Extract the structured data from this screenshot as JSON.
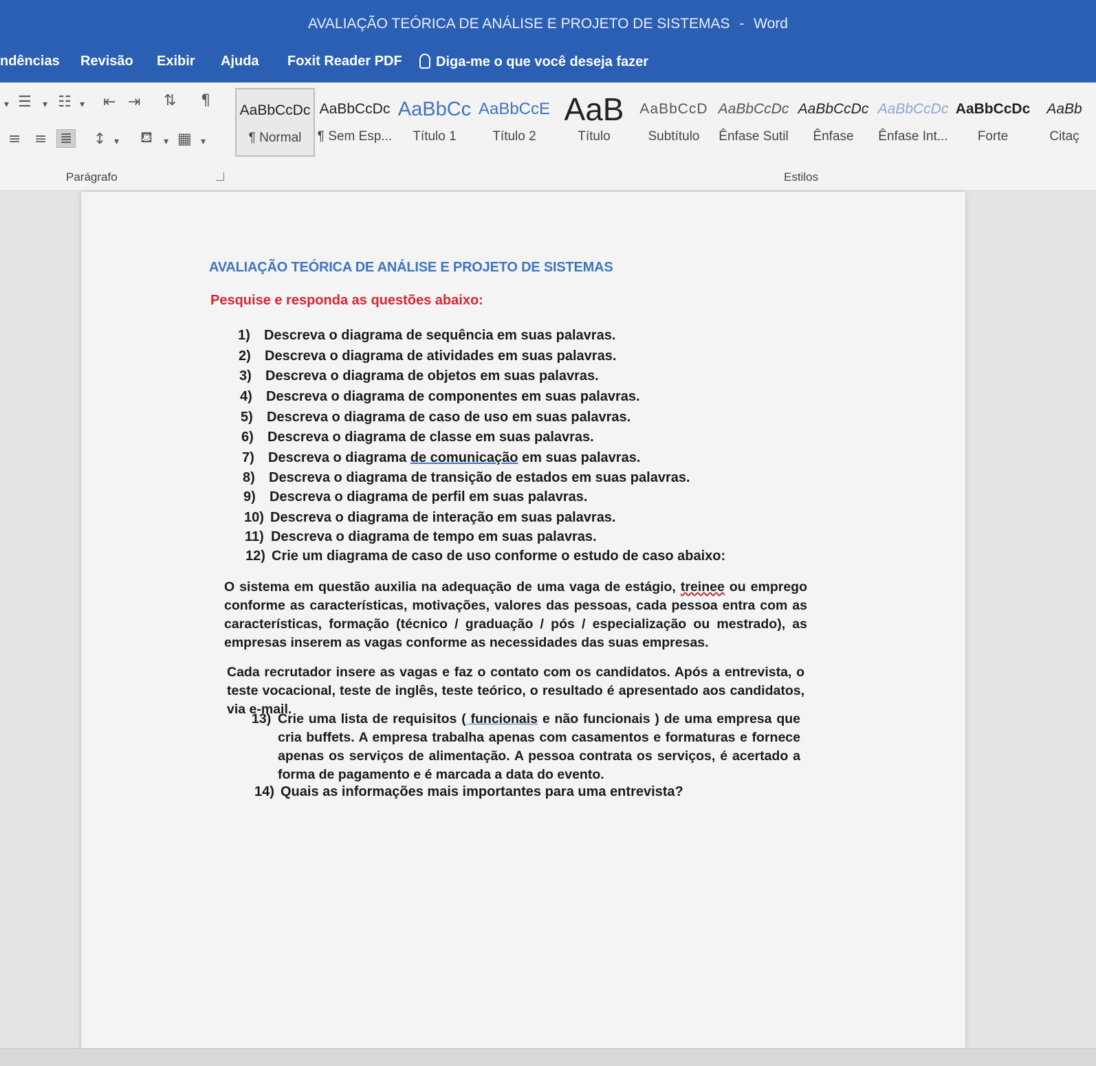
{
  "window": {
    "title": "AVALIAÇÃO TEÓRICA DE ANÁLISE E PROJETO DE SISTEMAS",
    "separator": "-",
    "app": "Word"
  },
  "menu": {
    "items": [
      "ndências",
      "Revisão",
      "Exibir",
      "Ajuda",
      "Foxit Reader PDF"
    ],
    "tell_me": "Diga-me o que você deseja fazer"
  },
  "ribbon": {
    "paragraph_label": "Parágrafo",
    "styles_label": "Estilos",
    "styles": [
      {
        "sample": "AaBbCcDc",
        "name": "¶ Normal"
      },
      {
        "sample": "AaBbCcDc",
        "name": "¶ Sem Esp..."
      },
      {
        "sample": "AaBbCc",
        "name": "Título 1"
      },
      {
        "sample": "AaBbCcE",
        "name": "Título 2"
      },
      {
        "sample": "AaB",
        "name": "Título"
      },
      {
        "sample": "AaBbCcD",
        "name": "Subtítulo"
      },
      {
        "sample": "AaBbCcDc",
        "name": "Ênfase Sutil"
      },
      {
        "sample": "AaBbCcDc",
        "name": "Ênfase"
      },
      {
        "sample": "AaBbCcDc",
        "name": "Ênfase Int..."
      },
      {
        "sample": "AaBbCcDc",
        "name": "Forte"
      },
      {
        "sample": "AaBb",
        "name": "Citaç"
      }
    ]
  },
  "document": {
    "title": "AVALIAÇÃO TEÓRICA DE ANÁLISE E PROJETO DE SISTEMAS",
    "subtitle": "Pesquise e responda as questões abaixo:",
    "questions": [
      {
        "num": "1)",
        "text": "Descreva o diagrama de sequência em suas palavras."
      },
      {
        "num": "2)",
        "text": "Descreva o diagrama de atividades em suas palavras."
      },
      {
        "num": "3)",
        "text": "Descreva o diagrama de objetos em suas palavras."
      },
      {
        "num": "4)",
        "text": "Descreva o diagrama de componentes em suas palavras."
      },
      {
        "num": "5)",
        "text": "Descreva o diagrama de caso de uso em suas palavras."
      },
      {
        "num": "6)",
        "text": "Descreva o diagrama de classe em suas palavras."
      },
      {
        "num": "7)",
        "text_a": "Descreva o diagrama ",
        "text_u": "de  comunicação",
        "text_b": " em suas palavras."
      },
      {
        "num": "8)",
        "text": "Descreva o diagrama de transição de estados em suas palavras."
      },
      {
        "num": "9)",
        "text": "Descreva o diagrama de perfil em suas palavras."
      },
      {
        "num": "10)",
        "text": "Descreva o diagrama de interação em suas palavras."
      },
      {
        "num": "11)",
        "text": "Descreva o diagrama de tempo em suas palavras."
      },
      {
        "num": "12)",
        "text": "Crie um diagrama de caso de uso conforme o estudo de caso abaixo:"
      }
    ],
    "case_p1": {
      "a": "O sistema em questão auxilia na adequação de uma vaga de estágio, ",
      "squiggle": "treinee",
      "b": " ou emprego conforme as características, motivações, valores das pessoas, cada pessoa entra com as características, formação (técnico / graduação / pós / especialização ou mestrado), as empresas inserem as vagas conforme as necessidades das suas empresas."
    },
    "case_p2": "Cada recrutador insere as vagas e faz o contato com os candidatos. Após a entrevista, o teste vocacional, teste de inglês, teste teórico, o resultado é apresentado aos candidatos, via e-mail.",
    "q13": {
      "num": "13)",
      "a": "Crie uma lista de requisitos ",
      "u": "( funcionais",
      "b": " e não funcionais ) de uma empresa que cria buffets. A empresa trabalha apenas com casamentos e formaturas e fornece apenas os serviços de alimentação. A pessoa contrata os serviços, é acertado a forma de pagamento e é marcada a data do evento."
    },
    "q14": {
      "num": "14)",
      "text": "Quais as informações mais importantes para uma entrevista?"
    }
  }
}
